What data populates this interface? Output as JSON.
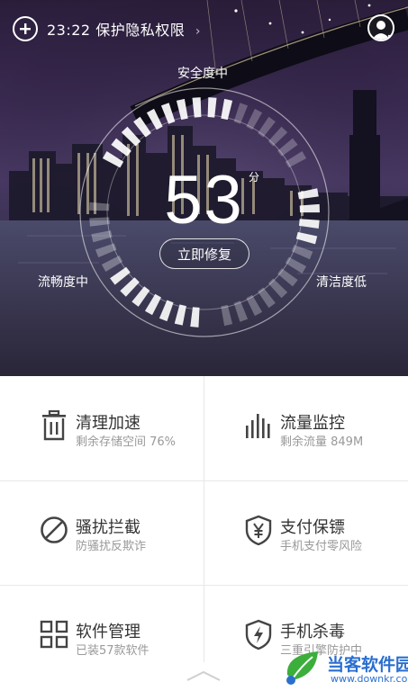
{
  "status_bar": {
    "time": "23:22",
    "text": "保护隐私权限",
    "chevron": "›"
  },
  "gauge": {
    "top_label": "安全度中",
    "left_label": "流畅度中",
    "right_label": "清洁度低",
    "score": "53",
    "score_unit": "分",
    "fix_button": "立即修复"
  },
  "features": [
    {
      "title": "清理加速",
      "subtitle": "剩余存储空间 76%",
      "icon": "trash-icon"
    },
    {
      "title": "流量监控",
      "subtitle": "剩余流量 849M",
      "icon": "bars-icon"
    },
    {
      "title": "骚扰拦截",
      "subtitle": "防骚扰反欺诈",
      "icon": "block-icon"
    },
    {
      "title": "支付保镖",
      "subtitle": "手机支付零风险",
      "icon": "yuan-shield-icon"
    },
    {
      "title": "软件管理",
      "subtitle": "已装57款软件",
      "icon": "grid-icon"
    },
    {
      "title": "手机杀毒",
      "subtitle": "三重引擎防护中",
      "icon": "bolt-shield-icon"
    }
  ],
  "watermark": {
    "text": "当客软件园",
    "url": "www.downkr.com"
  },
  "colors": {
    "accent": "#2a6fd0",
    "text": "#333333",
    "subtext": "#999999"
  }
}
